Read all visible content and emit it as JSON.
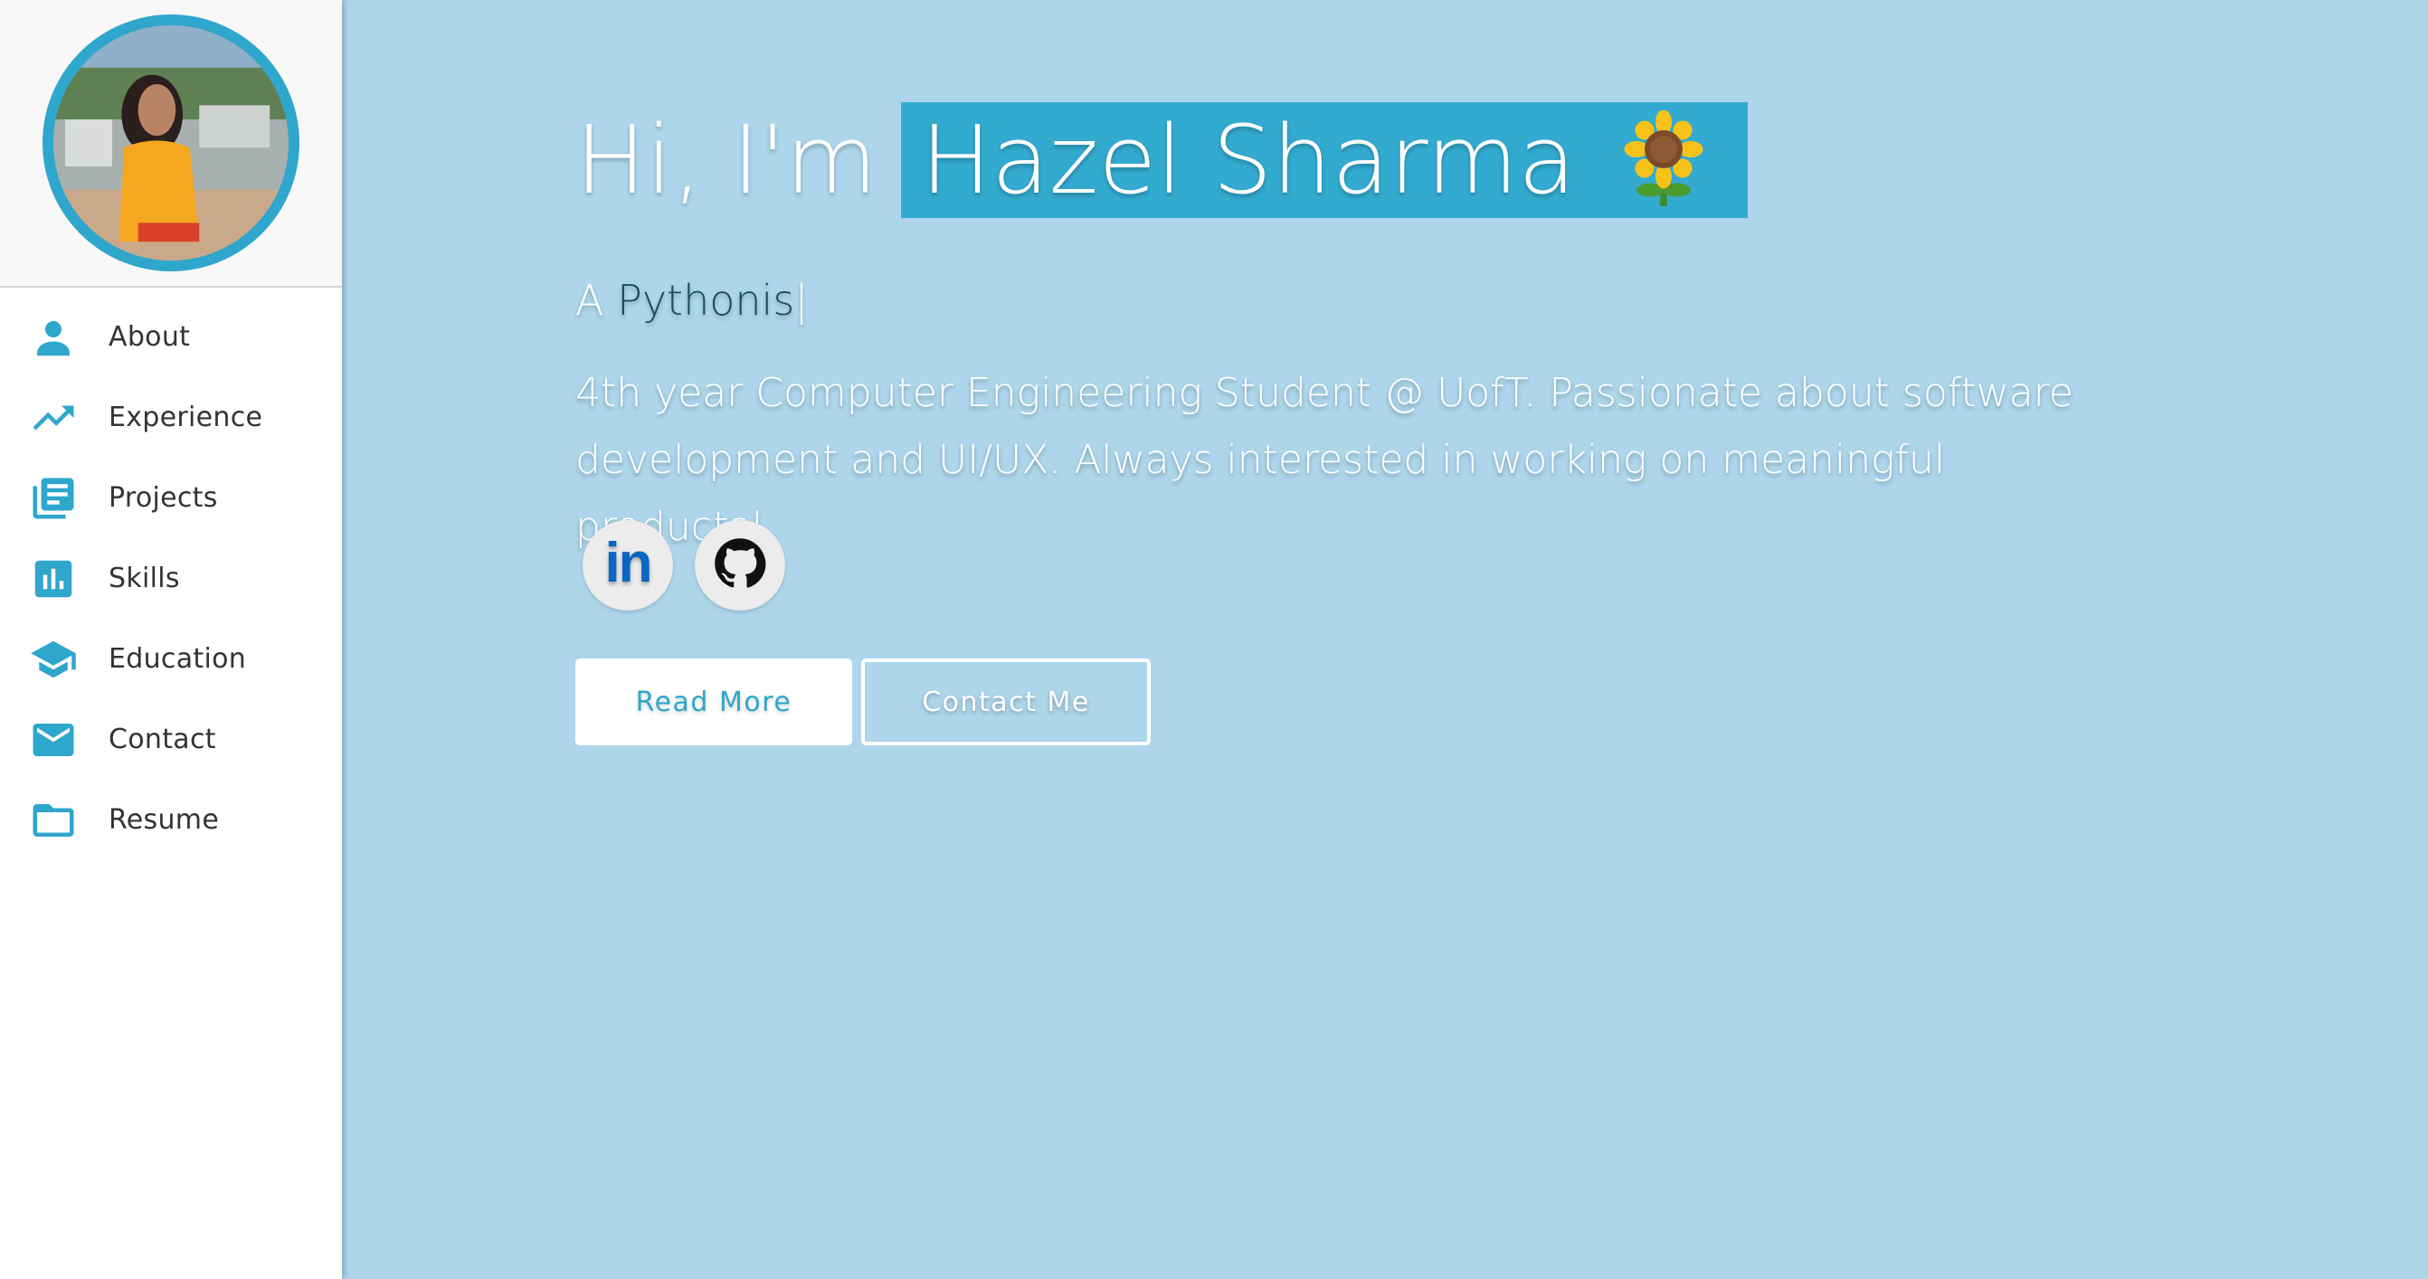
{
  "sidebar": {
    "avatar_alt": "Profile photo",
    "items": [
      {
        "label": "About",
        "icon": "person-icon"
      },
      {
        "label": "Experience",
        "icon": "trending-up-icon"
      },
      {
        "label": "Projects",
        "icon": "library-books-icon"
      },
      {
        "label": "Skills",
        "icon": "bar-chart-icon"
      },
      {
        "label": "Education",
        "icon": "school-icon"
      },
      {
        "label": "Contact",
        "icon": "mail-icon"
      },
      {
        "label": "Resume",
        "icon": "folder-icon"
      }
    ]
  },
  "hero": {
    "greeting": "Hi, I'm",
    "name": "Hazel Sharma",
    "emoji": "sunflower-icon",
    "subtitle_prefix": "A",
    "subtitle_typed": "Pythonis",
    "cursor": "|",
    "bio": "4th year Computer Engineering Student @ UofT. Passionate about software development and UI/UX. Always interested in working on meaningful products!"
  },
  "socials": {
    "linkedin": "in",
    "github": "github-icon"
  },
  "buttons": {
    "read_more": "Read More",
    "contact_me": "Contact Me"
  },
  "colors": {
    "accent": "#2fa6cc",
    "background": "#add6eb",
    "name_highlight": "#33abd0",
    "typed_text": "#1e4d57"
  }
}
